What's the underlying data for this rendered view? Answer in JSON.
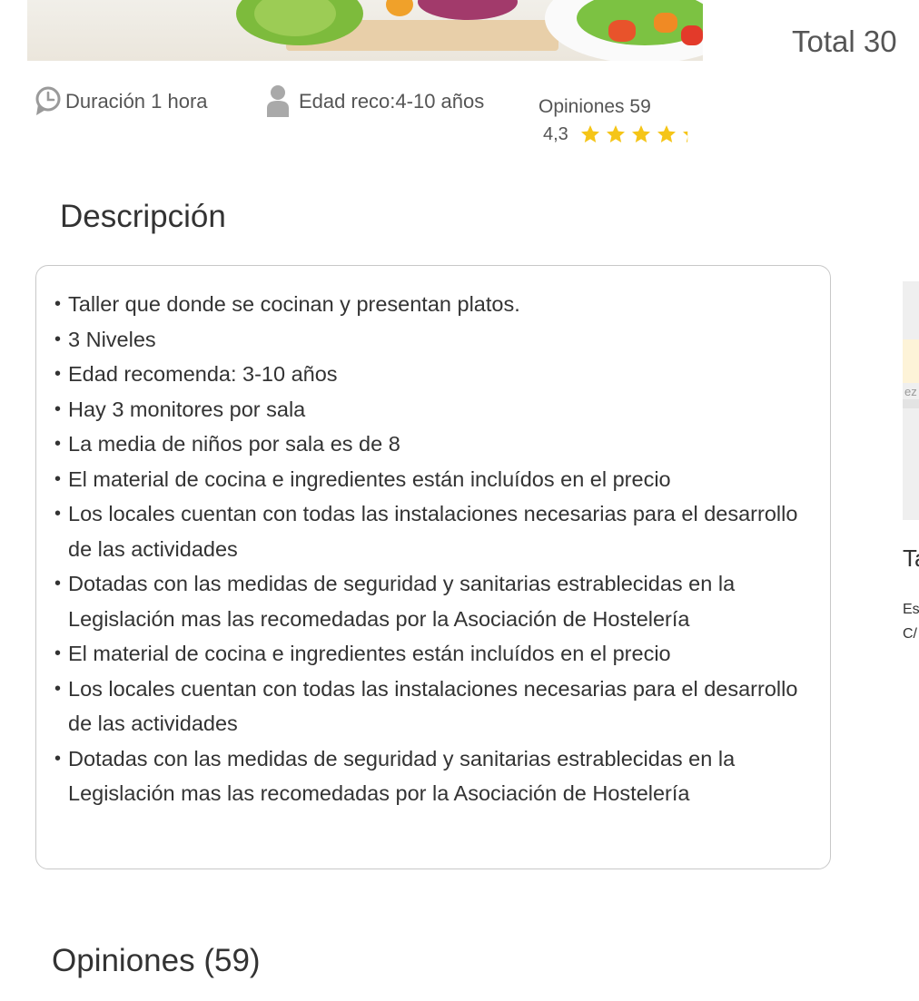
{
  "header": {
    "total_label": "Total 30"
  },
  "info": {
    "duration": "Duración 1 hora",
    "age": "Edad reco:4-10 años",
    "opinions_label": "Opiniones 59",
    "rating_value": "4,3",
    "rating_stars": 4.3
  },
  "description": {
    "title": "Descripción",
    "items": [
      "Taller que donde se cocinan y presentan platos.",
      "3 Niveles",
      "Edad recomenda: 3-10 años",
      "Hay 3 monitores por sala",
      "La media de niños por sala es de 8",
      "El material de cocina e ingredientes están incluídos en el precio",
      " Los locales cuentan con todas las instalaciones necesarias para el desarrollo de las actividades",
      "Dotadas con las medidas de seguridad y sanitarias estrablecidas en la Legislación mas las recomedadas por la Asociación de Hostelería",
      "El material de cocina e ingredientes están incluídos en el precio",
      " Los locales cuentan con todas las instalaciones necesarias para el desarrollo de las actividades",
      "Dotadas con las medidas de seguridad y sanitarias estrablecidas en la Legislación mas las recomedadas por la Asociación de Hostelería"
    ]
  },
  "opinions": {
    "title": "Opiniones (59)"
  },
  "side_card": {
    "fragment_small": "ez",
    "fragment_title": "Ta",
    "fragment_line1": "Es",
    "fragment_line2": "C/"
  },
  "colors": {
    "text": "#333333",
    "muted": "#555555",
    "star": "#f5c518",
    "border": "#c8c8c8"
  },
  "icons": [
    "clock-icon",
    "person-icon",
    "star-icon"
  ]
}
